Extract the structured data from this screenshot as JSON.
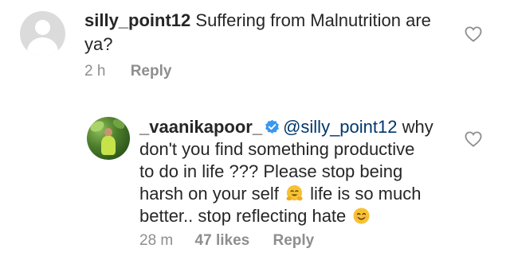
{
  "comments": [
    {
      "username": "silly_point12",
      "text_line1": " Suffering from Malnutrition are",
      "text_line2": "ya?",
      "time": "2 h",
      "reply_label": "Reply"
    },
    {
      "username": "_vaanikapoor_",
      "mention": "@silly_point12",
      "text_line1_after": " why",
      "text_line2": "don't you find something productive",
      "text_line3": "to do in life ??? Please stop being",
      "text_line4_before": "harsh on your self ",
      "text_line4_after": " life is so much",
      "text_line5": "better.. stop reflecting hate ",
      "time": "28 m",
      "likes": "47 likes",
      "reply_label": "Reply"
    }
  ],
  "icons": {
    "like": "heart-outline-icon",
    "verified": "verified-badge-icon",
    "hug_emoji": "hugging-face-emoji",
    "smile_emoji": "smiling-face-emoji"
  },
  "colors": {
    "text": "#262626",
    "meta": "#8e8e8e",
    "mention": "#00376b",
    "verified": "#3897f0"
  }
}
